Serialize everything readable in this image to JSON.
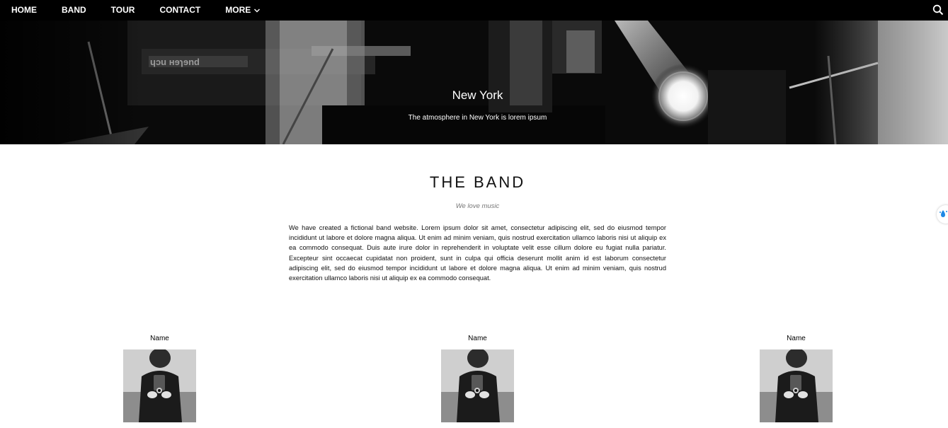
{
  "nav": {
    "items": [
      {
        "label": "HOME"
      },
      {
        "label": "BAND"
      },
      {
        "label": "TOUR"
      },
      {
        "label": "CONTACT"
      },
      {
        "label": "MORE"
      }
    ],
    "search_icon": "search-icon",
    "more_icon": "chevron-down-icon"
  },
  "hero": {
    "title": "New York",
    "subtitle": "The atmosphere in New York is lorem ipsum"
  },
  "band": {
    "title": "THE BAND",
    "tagline": "We love music",
    "description": "We have created a fictional band website. Lorem ipsum dolor sit amet, consectetur adipiscing elit, sed do eiusmod tempor incididunt ut labore et dolore magna aliqua. Ut enim ad minim veniam, quis nostrud exercitation ullamco laboris nisi ut aliquip ex ea commodo consequat. Duis aute irure dolor in reprehenderit in voluptate velit esse cillum dolore eu fugiat nulla pariatur. Excepteur sint occaecat cupidatat non proident, sunt in culpa qui officia deserunt mollit anim id est laborum consectetur adipiscing elit, sed do eiusmod tempor incididunt ut labore et dolore magna aliqua. Ut enim ad minim veniam, quis nostrud exercitation ullamco laboris nisi ut aliquip ex ea commodo consequat.",
    "members": [
      {
        "name": "Name"
      },
      {
        "name": "Name"
      },
      {
        "name": "Name"
      }
    ]
  },
  "colors": {
    "nav_bg": "#000000",
    "nav_text": "#ffffff",
    "tagline": "#777777",
    "widget_accent": "#1e88e5"
  }
}
